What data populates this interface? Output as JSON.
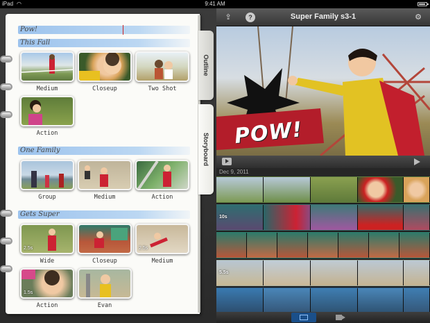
{
  "status_bar": {
    "device": "iPad",
    "time": "9:41 AM",
    "battery_level": 0.9
  },
  "notebook": {
    "tabs": [
      "Outline",
      "Storyboard"
    ],
    "title_line": "Pow!",
    "sections": [
      {
        "heading": "This Fall",
        "clips": [
          {
            "label": "Medium"
          },
          {
            "label": "Closeup"
          },
          {
            "label": "Two Shot"
          },
          {
            "label": "Action"
          }
        ]
      },
      {
        "heading": "One Family",
        "clips": [
          {
            "label": "Group"
          },
          {
            "label": "Medium"
          },
          {
            "label": "Action"
          }
        ]
      },
      {
        "heading": "Gets Super",
        "clips": [
          {
            "label": "Wide",
            "duration": "2.5s"
          },
          {
            "label": "Closeup"
          },
          {
            "label": "Medium"
          },
          {
            "label": "Action",
            "duration": "1.5s"
          },
          {
            "label": "Evan"
          }
        ]
      }
    ],
    "extra_durations": [
      "2.5s"
    ]
  },
  "project": {
    "title": "Super Family s3-1",
    "overlay_text": "POW!",
    "date": "Dec 9, 2011",
    "strip_labels": [
      "10s",
      "5.5s"
    ]
  },
  "icons": {
    "share": "share-icon",
    "help": "help-icon",
    "settings": "gear-icon",
    "play": "play-icon",
    "storyboard_view": "storyboard-view-icon",
    "camera": "camera-icon"
  },
  "colors": {
    "accent": "#1a4f8a",
    "banner": "#8cb9eb",
    "cursor": "#cc2222"
  }
}
